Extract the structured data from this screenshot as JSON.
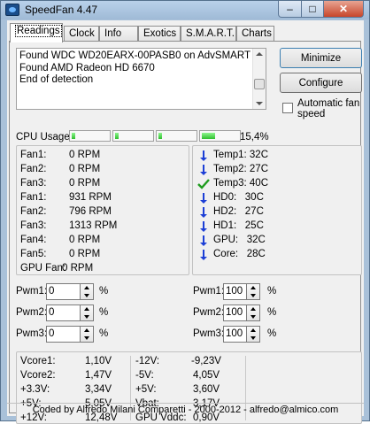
{
  "window": {
    "title": "SpeedFan 4.47",
    "minimize_glyph": "–",
    "maximize_glyph": "□",
    "close_glyph": "✕"
  },
  "tabs": [
    {
      "label": "Readings",
      "active": true
    },
    {
      "label": "Clock"
    },
    {
      "label": "Info"
    },
    {
      "label": "Exotics"
    },
    {
      "label": "S.M.A.R.T."
    },
    {
      "label": "Charts"
    }
  ],
  "log": {
    "lines": [
      "Found WDC WD20EARX-00PASB0 on AdvSMART",
      "Found AMD Radeon HD 6670",
      "End of detection"
    ]
  },
  "buttons": {
    "minimize": "Minimize",
    "configure": "Configure"
  },
  "automatic_fan_speed": {
    "label": "Automatic fan speed",
    "checked": false
  },
  "cpu_usage": {
    "label": "CPU Usage",
    "percent_text": "15,4%",
    "core_levels": [
      0.05,
      0.08,
      0.05,
      0.35
    ]
  },
  "fans": [
    {
      "label": "Fan1:",
      "value": "0 RPM"
    },
    {
      "label": "Fan2:",
      "value": "0 RPM"
    },
    {
      "label": "Fan3:",
      "value": "0 RPM"
    },
    {
      "label": "Fan1:",
      "value": "931 RPM"
    },
    {
      "label": "Fan2:",
      "value": "796 RPM"
    },
    {
      "label": "Fan3:",
      "value": "1313 RPM"
    },
    {
      "label": "Fan4:",
      "value": "0 RPM"
    },
    {
      "label": "Fan5:",
      "value": "0 RPM"
    },
    {
      "label": "GPU Fan:",
      "value": "0 RPM"
    }
  ],
  "temps": [
    {
      "text": "Temp1: 32C",
      "icon": "arrow-down-icon"
    },
    {
      "text": "Temp2: 27C",
      "icon": "arrow-down-icon"
    },
    {
      "text": "Temp3: 40C",
      "icon": "checkmark-icon"
    },
    {
      "text": "HD0:   30C",
      "icon": "arrow-down-icon"
    },
    {
      "text": "HD2:   27C",
      "icon": "arrow-down-icon"
    },
    {
      "text": "HD1:   25C",
      "icon": "arrow-down-icon"
    },
    {
      "text": "GPU:   32C",
      "icon": "arrow-down-icon"
    },
    {
      "text": "Core:   28C",
      "icon": "arrow-down-icon"
    }
  ],
  "pwm_left": [
    {
      "label": "Pwm1:",
      "value": "0",
      "unit": "%"
    },
    {
      "label": "Pwm2:",
      "value": "0",
      "unit": "%"
    },
    {
      "label": "Pwm3:",
      "value": "0",
      "unit": "%"
    }
  ],
  "pwm_right": [
    {
      "label": "Pwm1:",
      "value": "100",
      "unit": "%"
    },
    {
      "label": "Pwm2:",
      "value": "100",
      "unit": "%"
    },
    {
      "label": "Pwm3:",
      "value": "100",
      "unit": "%"
    }
  ],
  "voltages_col1": [
    {
      "label": "Vcore1:",
      "value": "1,10V"
    },
    {
      "label": "Vcore2:",
      "value": "1,47V"
    },
    {
      "label": "+3.3V:",
      "value": "3,34V"
    },
    {
      "label": "+5V:",
      "value": "5,05V"
    },
    {
      "label": "+12V:",
      "value": "12,48V"
    }
  ],
  "voltages_col2": [
    {
      "label": "-12V:",
      "value": "-9,23V"
    },
    {
      "label": "-5V:",
      "value": "4,05V"
    },
    {
      "label": "+5V:",
      "value": "3,60V"
    },
    {
      "label": "Vbat:",
      "value": "3,17V"
    },
    {
      "label": "GPU Vddc:",
      "value": "0,90V"
    }
  ],
  "status_bar": "Coded by Alfredo Milani Comparetti - 2000-2012 - alfredo@almico.com",
  "colors": {
    "arrow_blue": "#1c3fd6",
    "check_green": "#1e9b1e",
    "cpu_bar_green": "#2fbf2f"
  }
}
